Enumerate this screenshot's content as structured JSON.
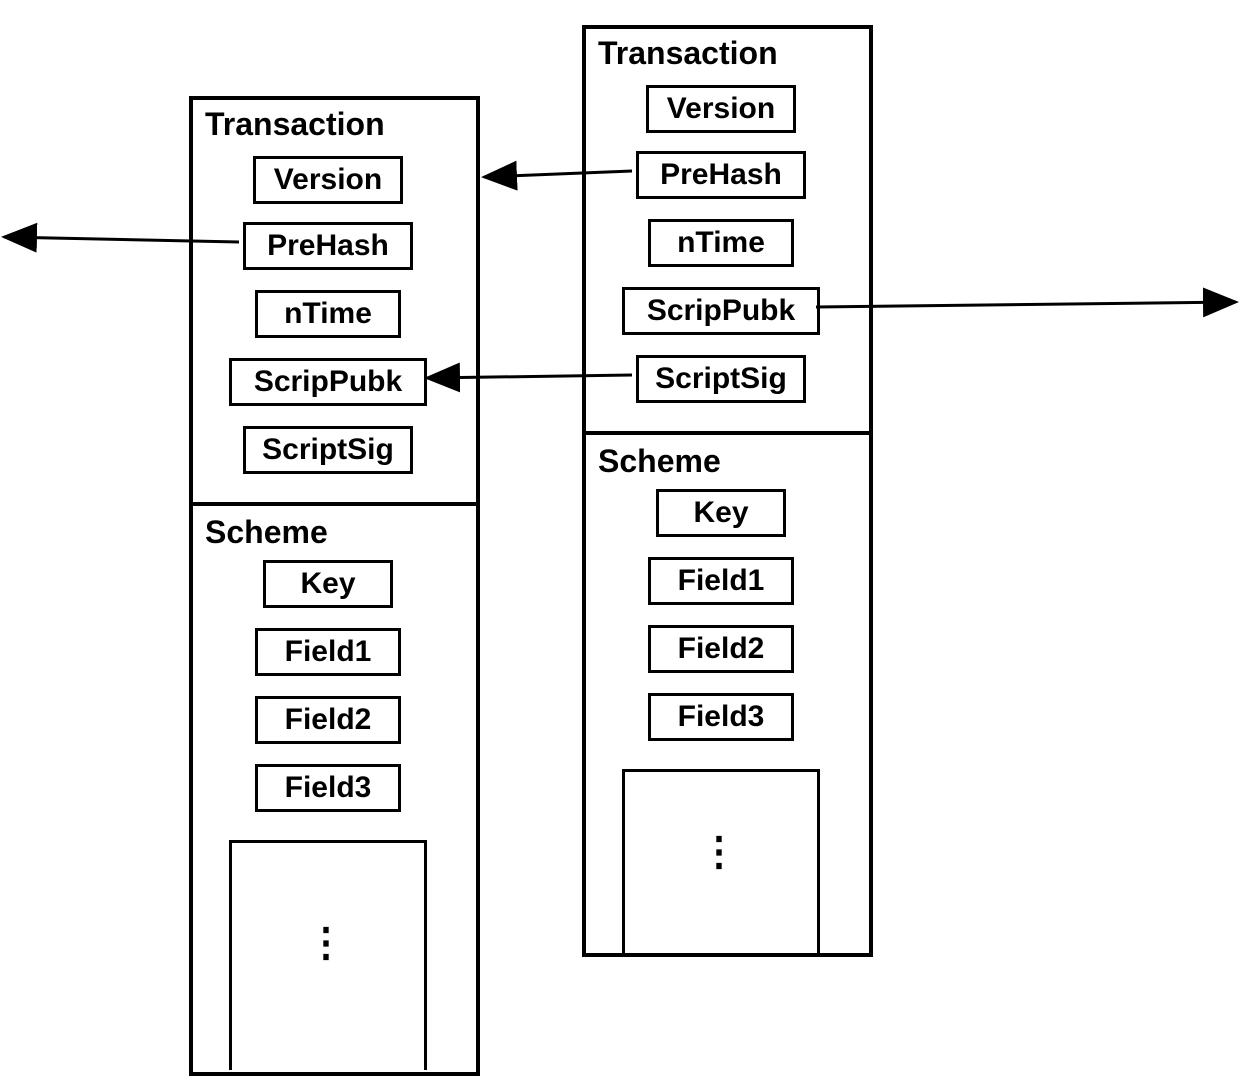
{
  "blocks": {
    "left": {
      "transaction": {
        "title": "Transaction",
        "fields": {
          "version": "Version",
          "prehash": "PreHash",
          "ntime": "nTime",
          "scrippubk": "ScripPubk",
          "scriptsig": "ScriptSig"
        }
      },
      "scheme": {
        "title": "Scheme",
        "fields": {
          "key": "Key",
          "field1": "Field1",
          "field2": "Field2",
          "field3": "Field3"
        }
      }
    },
    "right": {
      "transaction": {
        "title": "Transaction",
        "fields": {
          "version": "Version",
          "prehash": "PreHash",
          "ntime": "nTime",
          "scrippubk": "ScripPubk",
          "scriptsig": "ScriptSig"
        }
      },
      "scheme": {
        "title": "Scheme",
        "fields": {
          "key": "Key",
          "field1": "Field1",
          "field2": "Field2",
          "field3": "Field3"
        }
      }
    }
  },
  "arrows": [
    {
      "name": "left-prehash-out",
      "from": "left.transaction.prehash.left",
      "to": "offscreen-left"
    },
    {
      "name": "right-prehash-to-left-block",
      "from": "right.transaction.prehash.left",
      "to": "left.block.right"
    },
    {
      "name": "right-scriptsig-to-left-scrippubk",
      "from": "right.transaction.scriptsig.left",
      "to": "left.transaction.scrippubk.right"
    },
    {
      "name": "right-scrippubk-out",
      "from": "right.transaction.scrippubk.right",
      "to": "offscreen-right"
    }
  ]
}
